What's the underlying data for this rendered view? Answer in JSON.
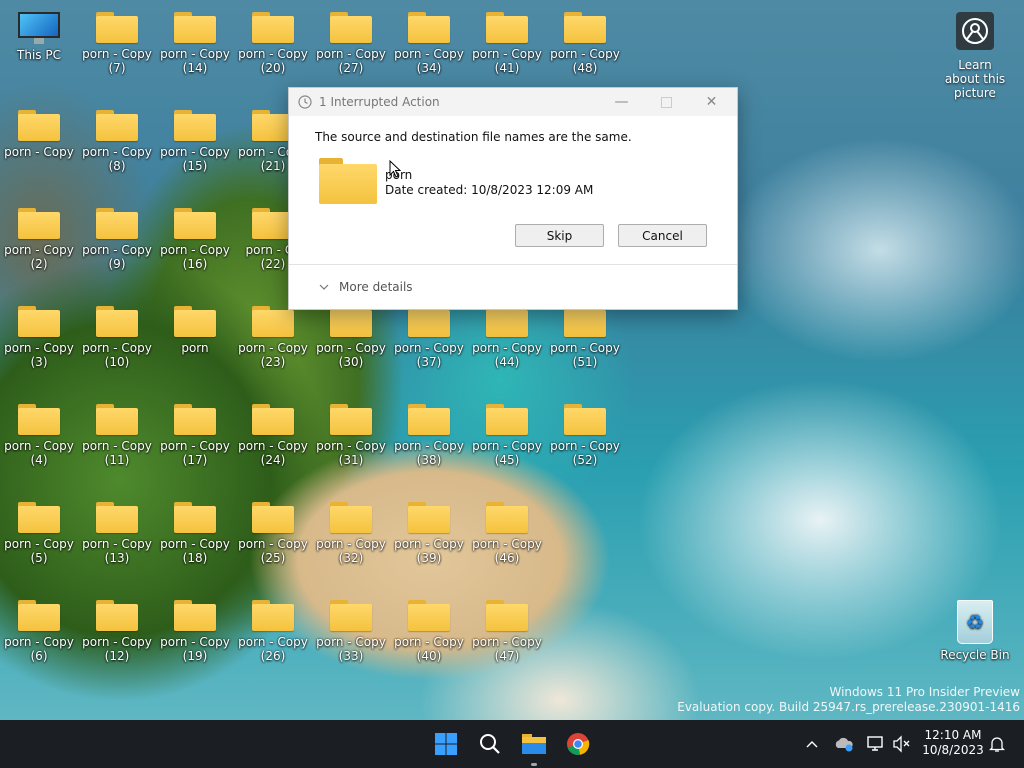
{
  "desktop": {
    "this_pc": "This PC",
    "recycle_bin": "Recycle Bin",
    "learn": "Learn about this picture",
    "folder_items": [
      {
        "line1": "porn - Copy",
        "line2": "(7)"
      },
      {
        "line1": "porn - Copy",
        "line2": "(14)"
      },
      {
        "line1": "porn - Copy",
        "line2": "(20)"
      },
      {
        "line1": "porn - Copy",
        "line2": "(27)"
      },
      {
        "line1": "porn - Copy",
        "line2": "(34)"
      },
      {
        "line1": "porn - Copy",
        "line2": "(41)"
      },
      {
        "line1": "porn - Copy",
        "line2": "(48)"
      },
      {
        "line1": "porn - Copy",
        "line2": ""
      },
      {
        "line1": "porn - Copy",
        "line2": "(8)"
      },
      {
        "line1": "porn - Copy",
        "line2": "(15)"
      },
      {
        "line1": "porn - Copy",
        "line2": "(21)"
      },
      {
        "line1": "porn - Copy",
        "line2": "(2)"
      },
      {
        "line1": "porn - Copy",
        "line2": "(9)"
      },
      {
        "line1": "porn - Copy",
        "line2": "(16)"
      },
      {
        "line1": "porn - Co",
        "line2": "(22)"
      },
      {
        "line1": "porn - Copy",
        "line2": "(3)"
      },
      {
        "line1": "porn - Copy",
        "line2": "(10)"
      },
      {
        "line1": "porn",
        "line2": ""
      },
      {
        "line1": "porn - Copy",
        "line2": "(23)"
      },
      {
        "line1": "porn - Copy",
        "line2": "(30)"
      },
      {
        "line1": "porn - Copy",
        "line2": "(37)"
      },
      {
        "line1": "porn - Copy",
        "line2": "(44)"
      },
      {
        "line1": "porn - Copy",
        "line2": "(51)"
      },
      {
        "line1": "porn - Copy",
        "line2": "(4)"
      },
      {
        "line1": "porn - Copy",
        "line2": "(11)"
      },
      {
        "line1": "porn - Copy",
        "line2": "(17)"
      },
      {
        "line1": "porn - Copy",
        "line2": "(24)"
      },
      {
        "line1": "porn - Copy",
        "line2": "(31)"
      },
      {
        "line1": "porn - Copy",
        "line2": "(38)"
      },
      {
        "line1": "porn - Copy",
        "line2": "(45)"
      },
      {
        "line1": "porn - Copy",
        "line2": "(52)"
      },
      {
        "line1": "porn - Copy",
        "line2": "(5)"
      },
      {
        "line1": "porn - Copy",
        "line2": "(13)"
      },
      {
        "line1": "porn - Copy",
        "line2": "(18)"
      },
      {
        "line1": "porn - Copy",
        "line2": "(25)"
      },
      {
        "line1": "porn - Copy",
        "line2": "(32)"
      },
      {
        "line1": "porn - Copy",
        "line2": "(39)"
      },
      {
        "line1": "porn - Copy",
        "line2": "(46)"
      },
      {
        "line1": "porn - Copy",
        "line2": "(6)"
      },
      {
        "line1": "porn - Copy",
        "line2": "(12)"
      },
      {
        "line1": "porn - Copy",
        "line2": "(19)"
      },
      {
        "line1": "porn - Copy",
        "line2": "(26)"
      },
      {
        "line1": "porn - Copy",
        "line2": "(33)"
      },
      {
        "line1": "porn - Copy",
        "line2": "(40)"
      },
      {
        "line1": "porn - Copy",
        "line2": "(47)"
      }
    ]
  },
  "dialog": {
    "title": "1 Interrupted Action",
    "message": "The source and destination file names are the same.",
    "file_name": "porn",
    "file_date": "Date created: 10/8/2023 12:09 AM",
    "skip_label": "Skip",
    "cancel_label": "Cancel",
    "more_details": "More details"
  },
  "watermark": {
    "line1": "Windows 11 Pro Insider Preview",
    "line2": "Evaluation copy. Build 25947.rs_prerelease.230901-1416"
  },
  "taskbar": {
    "time": "12:10 AM",
    "date": "10/8/2023",
    "icons": [
      "start-icon",
      "search-icon",
      "file-explorer-icon",
      "chrome-icon"
    ]
  },
  "colors": {
    "folder": "#f4c23e",
    "taskbar": "#1b1f24",
    "accent": "#0078d4"
  }
}
